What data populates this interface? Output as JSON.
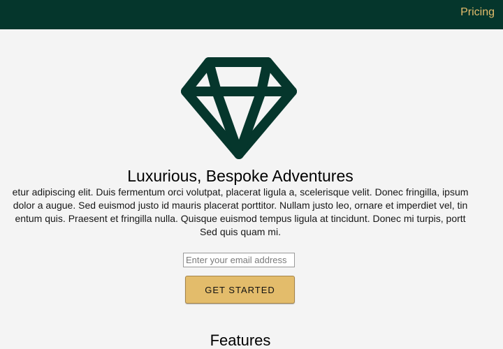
{
  "nav": {
    "pricing_label": "Pricing"
  },
  "hero": {
    "icon": "diamond-icon",
    "title": "Luxurious, Bespoke Adventures",
    "text_lines": [
      "etur adipiscing elit. Duis fermentum orci volutpat, placerat ligula a, scelerisque velit. Donec fringilla, ipsum",
      "dolor a augue. Sed euismod justo id mauris placerat porttitor. Nullam justo leo, ornare et imperdiet vel, tin",
      "entum quis. Praesent et fringilla nulla. Quisque euismod tempus ligula at tincidunt. Donec mi turpis, portt",
      "Sed quis quam mi."
    ]
  },
  "signup": {
    "email_placeholder": "Enter your email address",
    "button_label": "GET STARTED"
  },
  "features": {
    "title": "Features"
  },
  "colors": {
    "header_bg": "#05362c",
    "accent": "#e3bc6b",
    "page_bg": "#f4f4f4"
  }
}
